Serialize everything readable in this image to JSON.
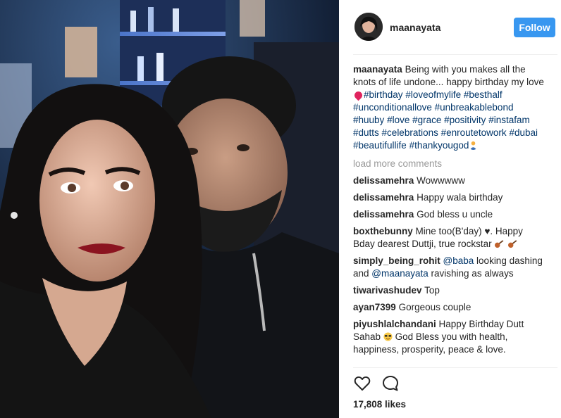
{
  "post": {
    "username": "maanayata",
    "follow_label": "Follow",
    "caption_user": "maanayata",
    "caption_text_1": "Being with you makes all the knots of life undone... happy birthday my love",
    "hashtags": [
      "#birthday",
      "#loveofmylife",
      "#besthalf",
      "#unconditionallove",
      "#unbreakablebond",
      "#huuby",
      "#love",
      "#grace",
      "#positivity",
      "#instafam",
      "#dutts",
      "#celebrations",
      "#enroutetowork",
      "#dubai",
      "#beautifullife",
      "#thankyougod"
    ],
    "load_more_label": "load more comments",
    "likes_label": "17,808 likes"
  },
  "comments": [
    {
      "user": "delissamehra",
      "text": "Wowwwww"
    },
    {
      "user": "delissamehra",
      "text": "Happy wala birthday"
    },
    {
      "user": "delissamehra",
      "text": "God bless u uncle"
    },
    {
      "user": "boxthebunny",
      "text_1": "Mine too(B'day) ♥. Happy Bday dearest Duttji, true rockstar"
    },
    {
      "user": "simply_being_rohit",
      "mention_1": "@baba",
      "text_1": " looking dashing and ",
      "mention_2": "@maanayata",
      "text_2": " ravishing as always"
    },
    {
      "user": "tiwarivashudev",
      "text": "Top"
    },
    {
      "user": "ayan7399",
      "text": "Gorgeous couple"
    },
    {
      "user": "piyushlalchandani",
      "text_1": "Happy Birthday Dutt Sahab",
      "text_2": "God Bless you with health, happiness, prosperity, peace & love."
    }
  ],
  "icons": {
    "like": "heart-outline-icon",
    "comment": "speech-bubble-icon",
    "caption_heart": "red-heart-emoji",
    "caption_end": "person-praying-emoji",
    "guitar": "guitar-emoji",
    "sunglasses": "smiling-face-with-sunglasses-emoji"
  },
  "colors": {
    "follow_button": "#3897f0",
    "hashtag": "#003569",
    "muted": "#999999",
    "text": "#262626"
  }
}
